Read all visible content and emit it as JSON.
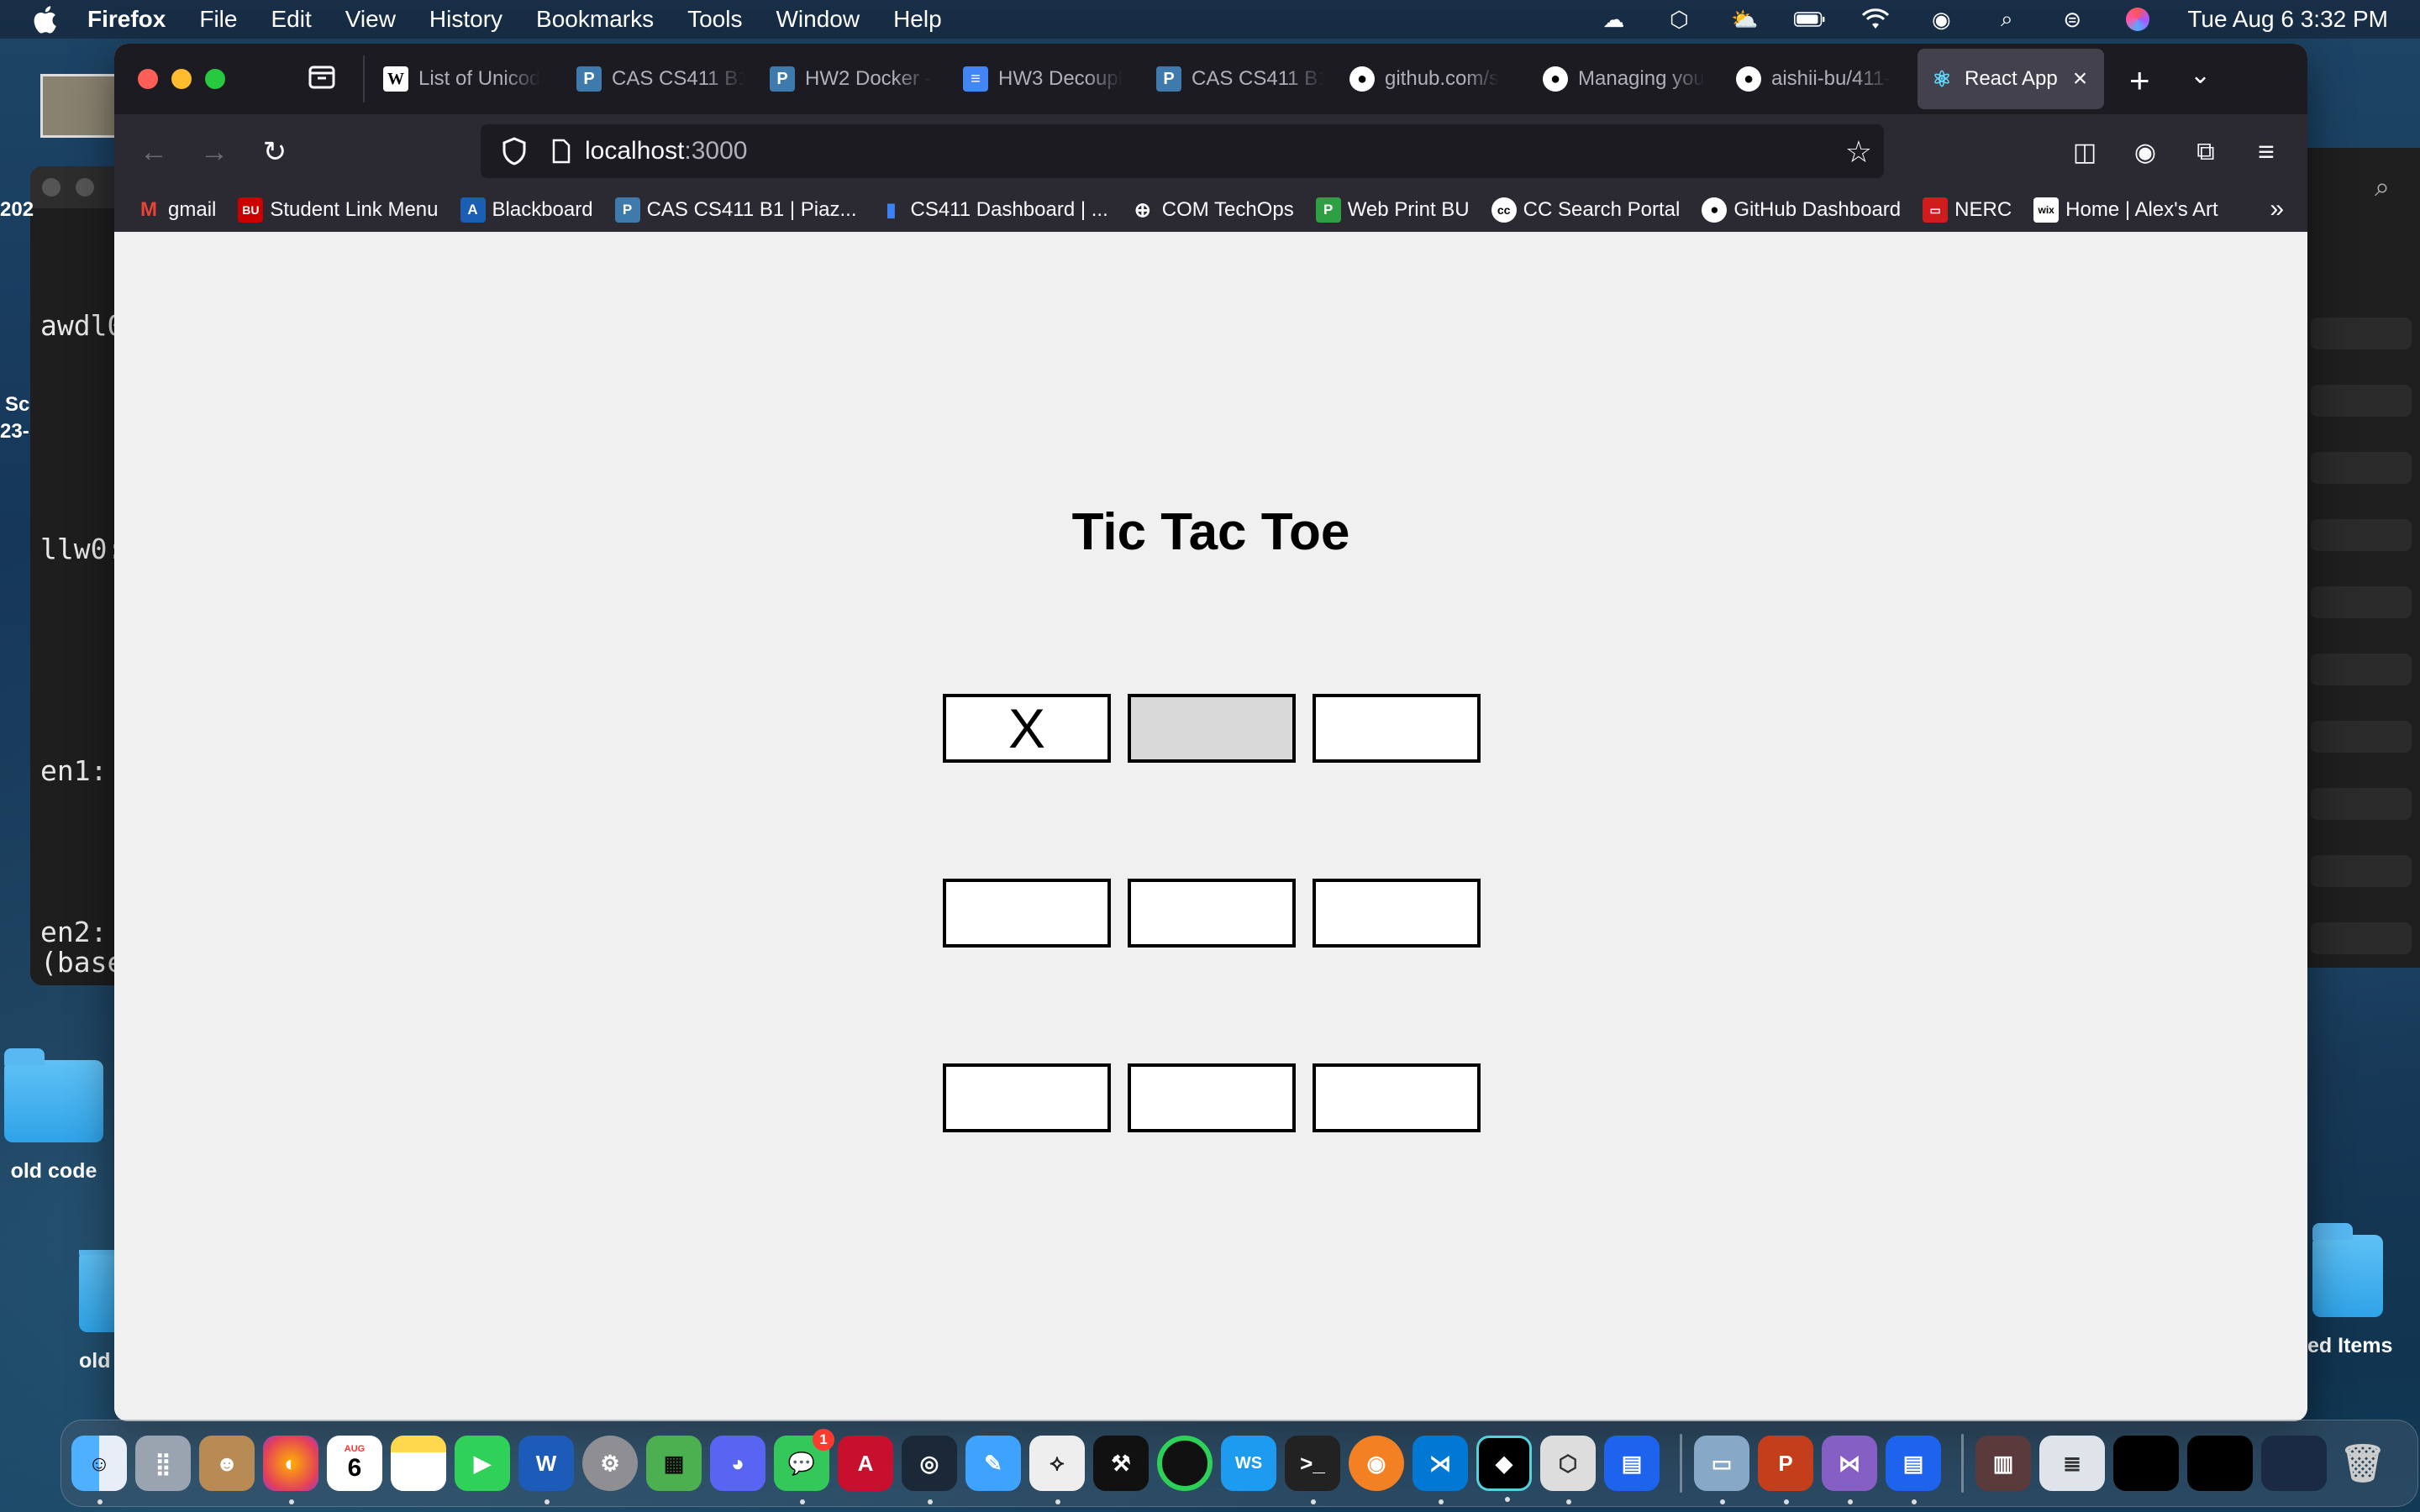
{
  "menubar": {
    "app_name": "Firefox",
    "items": [
      "File",
      "Edit",
      "View",
      "History",
      "Bookmarks",
      "Tools",
      "Window",
      "Help"
    ],
    "clock": "Tue Aug 6  3:32 PM"
  },
  "background": {
    "terminal_lines": [
      "awdl0",
      "llw0:",
      "en1:",
      "en2:",
      "(base"
    ],
    "terminal_prefix_lines": [
      "202",
      "Sc",
      "23-"
    ],
    "desktop_folders": [
      "old code",
      "old",
      "ed Items"
    ]
  },
  "browser": {
    "tabs": [
      {
        "icon": "wikipedia-icon",
        "label": "List of Unicod"
      },
      {
        "icon": "piazza-icon",
        "label": "CAS CS411 B1"
      },
      {
        "icon": "piazza-icon",
        "label": "HW2 Docker -"
      },
      {
        "icon": "docs-icon",
        "label": "HW3 Decoupl"
      },
      {
        "icon": "piazza-icon",
        "label": "CAS CS411 B1"
      },
      {
        "icon": "github-icon",
        "label": "github.com/s"
      },
      {
        "icon": "github-icon",
        "label": "Managing you"
      },
      {
        "icon": "github-icon",
        "label": "aishii-bu/411-"
      },
      {
        "icon": "react-icon",
        "label": "React App",
        "active": true
      }
    ],
    "url_host": "localhost",
    "url_port": ":3000",
    "bookmarks": [
      {
        "icon": "gmail-icon",
        "label": "gmail"
      },
      {
        "icon": "bu-icon",
        "label": "Student Link Menu"
      },
      {
        "icon": "blackboard-icon",
        "label": "Blackboard"
      },
      {
        "icon": "piazza-icon",
        "label": "CAS CS411 B1 | Piaz..."
      },
      {
        "icon": "chart-icon",
        "label": "CS411 Dashboard | ..."
      },
      {
        "icon": "globe-icon",
        "label": "COM TechOps"
      },
      {
        "icon": "print-icon",
        "label": "Web Print BU"
      },
      {
        "icon": "cc-icon",
        "label": "CC Search Portal"
      },
      {
        "icon": "github-icon",
        "label": "GitHub Dashboard"
      },
      {
        "icon": "nerc-icon",
        "label": "NERC"
      },
      {
        "icon": "wix-icon",
        "label": "Home | Alex's Art"
      }
    ]
  },
  "game": {
    "title": "Tic Tac Toe",
    "board": [
      "X",
      "",
      "",
      "",
      "",
      "",
      "",
      "",
      ""
    ]
  },
  "dock": {
    "calendar_month": "AUG",
    "calendar_day": "6",
    "messages_badge": "1"
  },
  "colors": {
    "browser_chrome": "#1c1b22",
    "toolbar": "#2b2a33",
    "page_bg": "#f0f0f0",
    "hovered_cell": "#d9d9d9"
  }
}
